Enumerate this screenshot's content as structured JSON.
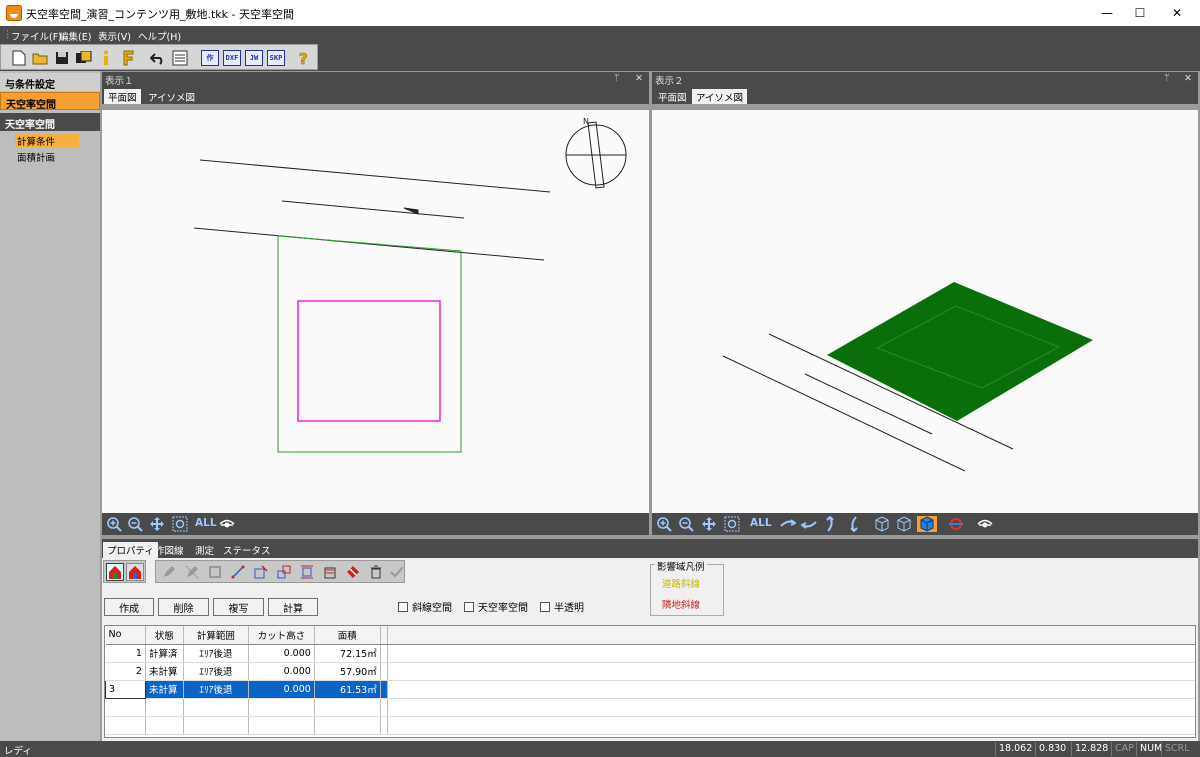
{
  "window": {
    "title": "天空率空間_演習_コンテンツ用_敷地.tkk - 天空率空間",
    "minimize": "—",
    "maximize": "☐",
    "close": "✕"
  },
  "menu": [
    "ファイル(F)",
    "編集(E)",
    "表示(V)",
    "ヘルプ(H)"
  ],
  "toolbar": {
    "buttons": [
      "new-file",
      "open-folder",
      "save",
      "save-all",
      "info",
      "file-F",
      "undo",
      "settings-list",
      "作",
      "DXF",
      "JW",
      "SKP",
      "help"
    ]
  },
  "left_panel": {
    "section1": "与条件設定",
    "section1_active": "天空率空間",
    "section2": "天空率空間",
    "items": [
      "計算条件",
      "面積計画"
    ]
  },
  "pane1": {
    "title": "表示１",
    "tabs": [
      "平面図",
      "アイソメ図"
    ],
    "all_label": "ALL"
  },
  "pane2": {
    "title": "表示２",
    "tabs": [
      "平面図",
      "アイソメ図"
    ],
    "all_label": "ALL"
  },
  "pane_controls": {
    "pin": "ᛘ",
    "close": "✕"
  },
  "bottom": {
    "tabs": [
      "プロパティ",
      "作図線",
      "測定",
      "ステータス"
    ],
    "buttons": [
      "作成",
      "削除",
      "複写",
      "計算"
    ],
    "checkboxes": [
      "斜線空間",
      "天空率空間",
      "半透明"
    ],
    "legend": {
      "title": "影響域凡例",
      "items": [
        {
          "label": "道路斜線",
          "color": "#c8b400"
        },
        {
          "label": "隣地斜線",
          "color": "#cc2222"
        }
      ]
    },
    "table": {
      "headers": [
        "No",
        "状態",
        "計算範囲",
        "カット高さ",
        "面積"
      ],
      "rows": [
        {
          "no": "1",
          "status": "計算済",
          "range": "ｴﾘｱ後退",
          "cut": "0.000",
          "area": "72.15㎡"
        },
        {
          "no": "2",
          "status": "未計算",
          "range": "ｴﾘｱ後退",
          "cut": "0.000",
          "area": "57.90㎡"
        },
        {
          "no": "3",
          "status": "未計算",
          "range": "ｴﾘｱ後退",
          "cut": "0.000",
          "area": "61.53㎡"
        }
      ]
    }
  },
  "statusbar": {
    "message": "レディ",
    "fields": [
      "18.062",
      "0.830",
      "12.828",
      "CAP",
      "NUM",
      "SCRL"
    ]
  },
  "colors": {
    "site": "#2e9e2e",
    "building": "#ee22dd",
    "iso_fill": "#0a6e0a",
    "accent": "#f5a030",
    "selection": "#0a64c8"
  }
}
